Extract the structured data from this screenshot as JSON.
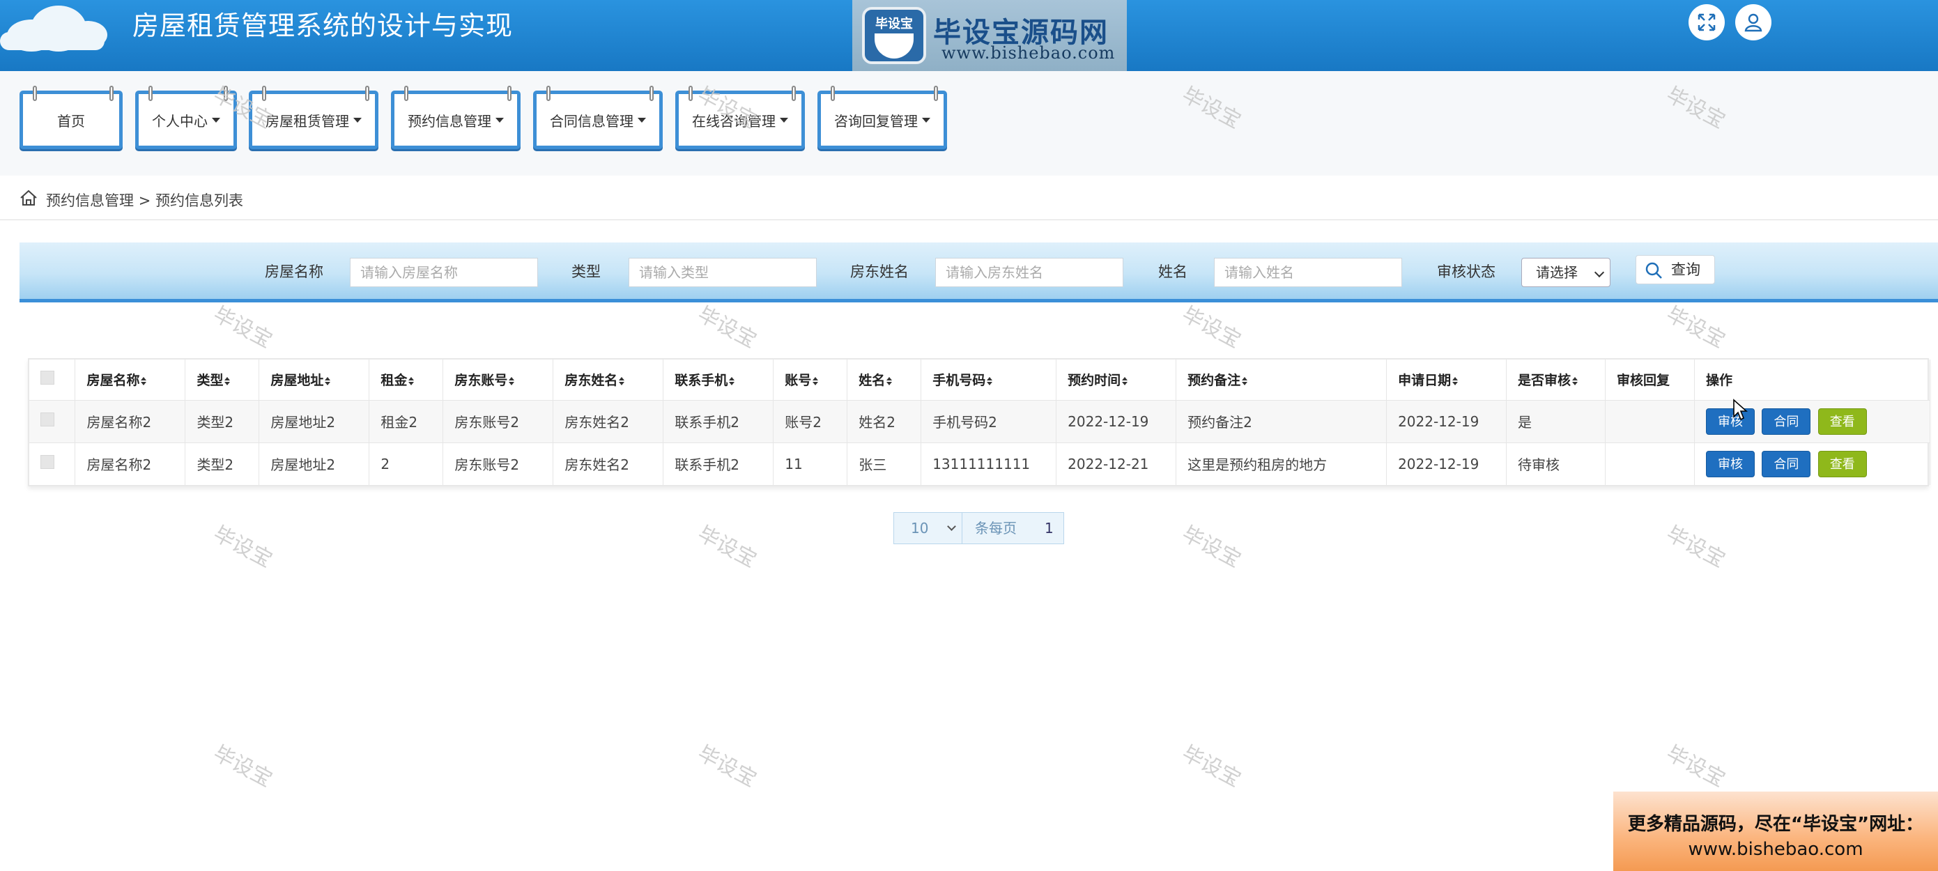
{
  "header": {
    "title": "房屋租赁管理系统的设计与实现",
    "logo_badge": "毕设宝",
    "logo_name": "毕设宝源码网",
    "logo_url": "www.bishebao.com",
    "icons": [
      "fullscreen-icon",
      "user-icon"
    ]
  },
  "nav": {
    "items": [
      {
        "label": "首页",
        "dropdown": false
      },
      {
        "label": "个人中心",
        "dropdown": true
      },
      {
        "label": "房屋租赁管理",
        "dropdown": true
      },
      {
        "label": "预约信息管理",
        "dropdown": true
      },
      {
        "label": "合同信息管理",
        "dropdown": true
      },
      {
        "label": "在线咨询管理",
        "dropdown": true
      },
      {
        "label": "咨询回复管理",
        "dropdown": true
      }
    ]
  },
  "breadcrumb": {
    "parent": "预约信息管理",
    "separator": ">",
    "current": "预约信息列表"
  },
  "search": {
    "house_name_label": "房屋名称",
    "house_name_placeholder": "请输入房屋名称",
    "type_label": "类型",
    "type_placeholder": "请输入类型",
    "landlord_label": "房东姓名",
    "landlord_placeholder": "请输入房东姓名",
    "name_label": "姓名",
    "name_placeholder": "请输入姓名",
    "status_label": "审核状态",
    "status_value": "请选择",
    "query_button": "查询"
  },
  "table": {
    "columns": [
      "房屋名称",
      "类型",
      "房屋地址",
      "租金",
      "房东账号",
      "房东姓名",
      "联系手机",
      "账号",
      "姓名",
      "手机号码",
      "预约时间",
      "预约备注",
      "申请日期",
      "是否审核",
      "审核回复",
      "操作"
    ],
    "rows": [
      [
        "房屋名称2",
        "类型2",
        "房屋地址2",
        "租金2",
        "房东账号2",
        "房东姓名2",
        "联系手机2",
        "账号2",
        "姓名2",
        "手机号码2",
        "2022-12-19",
        "预约备注2",
        "2022-12-19",
        "是",
        ""
      ],
      [
        "房屋名称2",
        "类型2",
        "房屋地址2",
        "2",
        "房东账号2",
        "房东姓名2",
        "联系手机2",
        "11",
        "张三",
        "13111111111",
        "2022-12-21",
        "这里是预约租房的地方",
        "2022-12-19",
        "待审核",
        ""
      ]
    ],
    "actions": {
      "review": "审核",
      "contract": "合同",
      "view": "查看"
    }
  },
  "pagination": {
    "page_size": "10",
    "per_page_label": "条每页",
    "current_page": "1"
  },
  "watermark": "毕设宝",
  "promo": {
    "line1": "更多精品源码，尽在“毕设宝”网址：",
    "line2": "www.bishebao.com"
  },
  "colors": {
    "header_blue": "#1f85d2",
    "nav_border": "#3d8fd6",
    "button_blue": "#1f6fc0",
    "button_green": "#8fb81b"
  }
}
